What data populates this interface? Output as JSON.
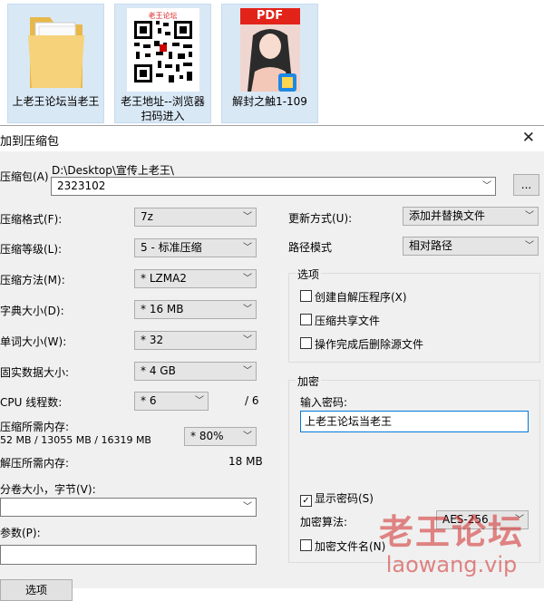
{
  "desktop": {
    "items": [
      {
        "label": "上老王论坛当老王",
        "icon": "folder-icon"
      },
      {
        "label": "老王地址--浏览器扫码进入",
        "icon": "qr-code-icon",
        "qr_title": "老王论坛"
      },
      {
        "label": "解封之触1-109",
        "icon": "pdf-file-icon",
        "badge": "PDF"
      }
    ]
  },
  "dialog": {
    "title": "加到压缩包",
    "archive_label": "压缩包(A)",
    "archive_path": "D:\\Desktop\\宣传上老王\\",
    "archive_name": "2323102",
    "browse_label": "...",
    "format": {
      "label": "压缩格式(F):",
      "value": "7z"
    },
    "level": {
      "label": "压缩等级(L):",
      "value": "5 - 标准压缩"
    },
    "method": {
      "label": "压缩方法(M):",
      "value": "* LZMA2"
    },
    "dict": {
      "label": "字典大小(D):",
      "value": "* 16 MB"
    },
    "word": {
      "label": "单词大小(W):",
      "value": "* 32"
    },
    "solid": {
      "label": "固实数据大小:",
      "value": "* 4 GB"
    },
    "threads": {
      "label": "CPU 线程数:",
      "value": "* 6",
      "max": "/ 6"
    },
    "mem_compress": {
      "label": "压缩所需内存:",
      "detail": "52 MB / 13055 MB / 16319 MB",
      "percent": "* 80%"
    },
    "mem_decompress": {
      "label": "解压所需内存:",
      "value": "18 MB"
    },
    "volume": {
      "label": "分卷大小，字节(V):"
    },
    "params": {
      "label": "参数(P):"
    },
    "update": {
      "label": "更新方式(U):",
      "value": "添加并替换文件"
    },
    "path_mode": {
      "label": "路径模式",
      "value": "相对路径"
    },
    "options": {
      "title": "选项",
      "sfx": "创建自解压程序(X)",
      "shared": "压缩共享文件",
      "delete": "操作完成后删除源文件"
    },
    "encryption": {
      "title": "加密",
      "password_label": "输入密码:",
      "password_value": "上老王论坛当老王",
      "show_password": "显示密码(S)",
      "show_password_checked": true,
      "method_label": "加密算法:",
      "method_value": "AES-256",
      "encrypt_names": "加密文件名(N)"
    },
    "bottom_button": "选项"
  },
  "watermark": {
    "cn": "老王论坛",
    "en": "laowang.vip"
  }
}
